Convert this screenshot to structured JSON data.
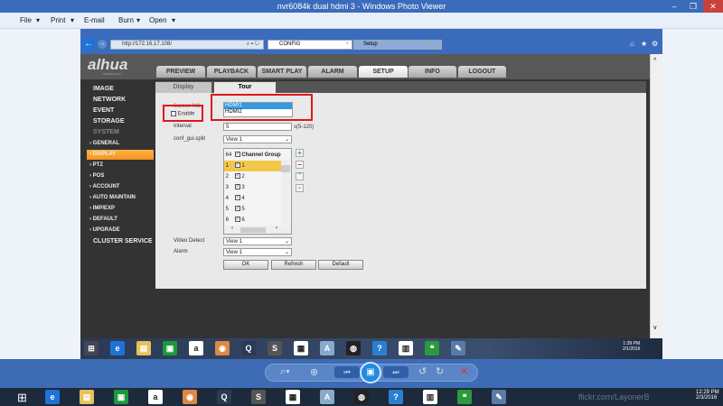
{
  "window": {
    "title": "nvr6084k dual hdmi 3 - Windows Photo Viewer",
    "minimize": "–",
    "restore": "❐",
    "close": "✕"
  },
  "menu": [
    "File",
    "Print",
    "E-mail",
    "Burn",
    "Open"
  ],
  "browser": {
    "url": "http://172.16.17.108/",
    "search_glyph": "⌕ ▾ ↻",
    "tabs": [
      "CONFIG",
      "Setup"
    ],
    "close_tab": "×"
  },
  "dahua": {
    "logo": "alhua",
    "logo_sub": "TECHNOLOGY",
    "tabs": [
      "PREVIEW",
      "PLAYBACK",
      "SMART PLAY",
      "ALARM",
      "SETUP",
      "INFO",
      "LOGOUT"
    ],
    "active_tab": "SETUP"
  },
  "sidebar": {
    "items": [
      "IMAGE",
      "NETWORK",
      "EVENT",
      "STORAGE",
      "SYSTEM"
    ],
    "system_sub": [
      "GENERAL",
      "DISPLAY",
      "PTZ",
      "POS",
      "ACCOUNT",
      "AUTO MAINTAIN",
      "IMP/EXP",
      "DEFAULT",
      "UPGRADE"
    ],
    "active": "DISPLAY",
    "last": "CLUSTER SERVICE"
  },
  "subtabs": [
    "Display",
    "Tour"
  ],
  "form": {
    "screen_label": "Screen NO.",
    "enable_label": "Enable",
    "screen_options": [
      "HDMI1",
      "HDMI2"
    ],
    "interval_label": "Interval",
    "interval_value": "5",
    "interval_hint": "s(5-120)",
    "split_label": "conf_gui.split",
    "split_value": "View 1",
    "channel_header": {
      "num": "64",
      "label": "Channel Group"
    },
    "channels": [
      [
        "1",
        "1"
      ],
      [
        "2",
        "2"
      ],
      [
        "3",
        "3"
      ],
      [
        "4",
        "4"
      ],
      [
        "5",
        "5"
      ],
      [
        "6",
        "6"
      ]
    ],
    "video_detect_label": "Video Detect",
    "video_detect_value": "View 1",
    "alarm_label": "Alarm",
    "alarm_value": "View 1",
    "ok": "OK",
    "refresh": "Refresh",
    "default": "Default"
  },
  "inner_clock": {
    "time": "1:39 PM",
    "date": "2/1/2016"
  },
  "outer_clock": {
    "time": "12:29 PM",
    "date": "2/3/2016"
  },
  "watermark": "flickr.com/LayonerB",
  "colors": {
    "accent": "#f7931e",
    "titlebar": "#3b6cbc",
    "highlight": "#f2c84b",
    "red_annotation": "#e0161c"
  }
}
